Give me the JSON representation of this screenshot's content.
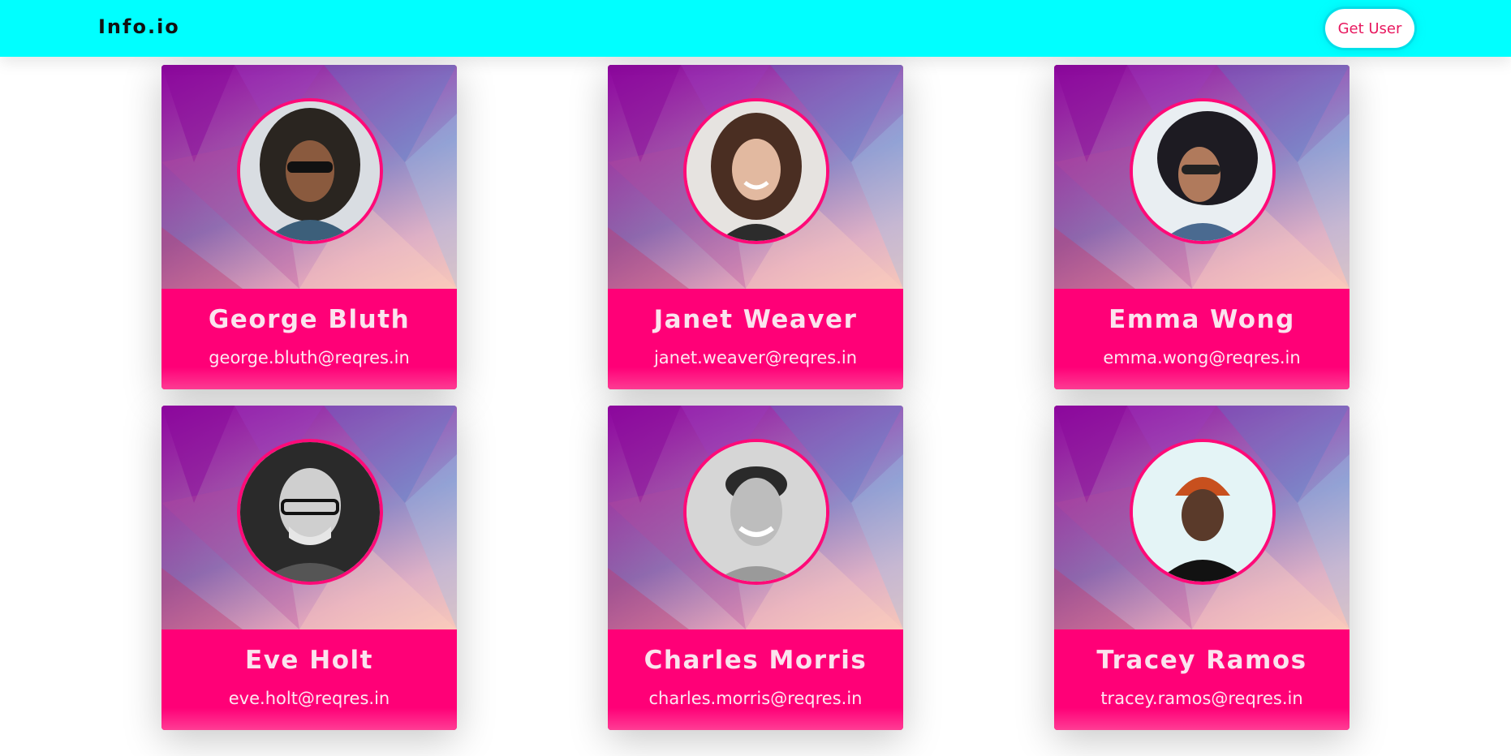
{
  "navbar": {
    "brand": "Info.io",
    "get_user_label": "Get User",
    "background": "#00ffff"
  },
  "colors": {
    "card_body": "#ff0077",
    "avatar_ring": "#ff0a78",
    "button_text": "#e8185f"
  },
  "users": [
    {
      "name": "George Bluth",
      "email": "george.bluth@reqres.in"
    },
    {
      "name": "Janet Weaver",
      "email": "janet.weaver@reqres.in"
    },
    {
      "name": "Emma Wong",
      "email": "emma.wong@reqres.in"
    },
    {
      "name": "Eve Holt",
      "email": "eve.holt@reqres.in"
    },
    {
      "name": "Charles Morris",
      "email": "charles.morris@reqres.in"
    },
    {
      "name": "Tracey Ramos",
      "email": "tracey.ramos@reqres.in"
    }
  ]
}
